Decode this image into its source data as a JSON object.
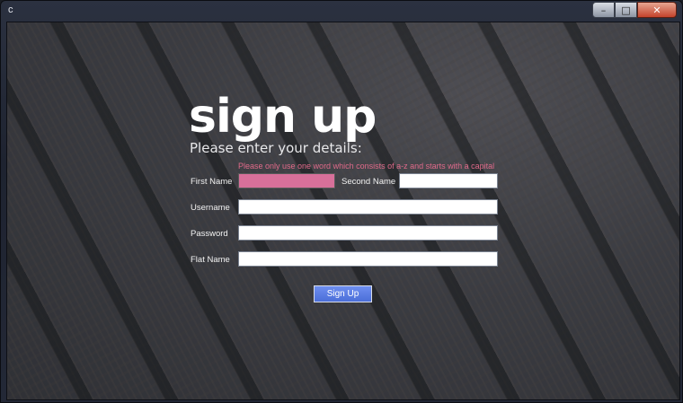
{
  "window": {
    "title": "c"
  },
  "caption": {
    "minimize": "–",
    "maximize": "□",
    "close": "✕"
  },
  "form": {
    "heading": "sign up",
    "subheading": "Please enter your details:",
    "validation_hint": "Please only use one word which consists of a-z and starts with a capital",
    "first_name_label": "First Name",
    "first_name_value": "",
    "second_name_label": "Second Name",
    "second_name_value": "",
    "username_label": "Username",
    "username_value": "",
    "password_label": "Password",
    "password_value": "",
    "flat_name_label": "Flat Name",
    "flat_name_value": "",
    "submit_label": "Sign Up"
  },
  "colors": {
    "error_field": "#d8709a",
    "hint_text": "#e06a8a",
    "button": "#5a7fe6"
  }
}
